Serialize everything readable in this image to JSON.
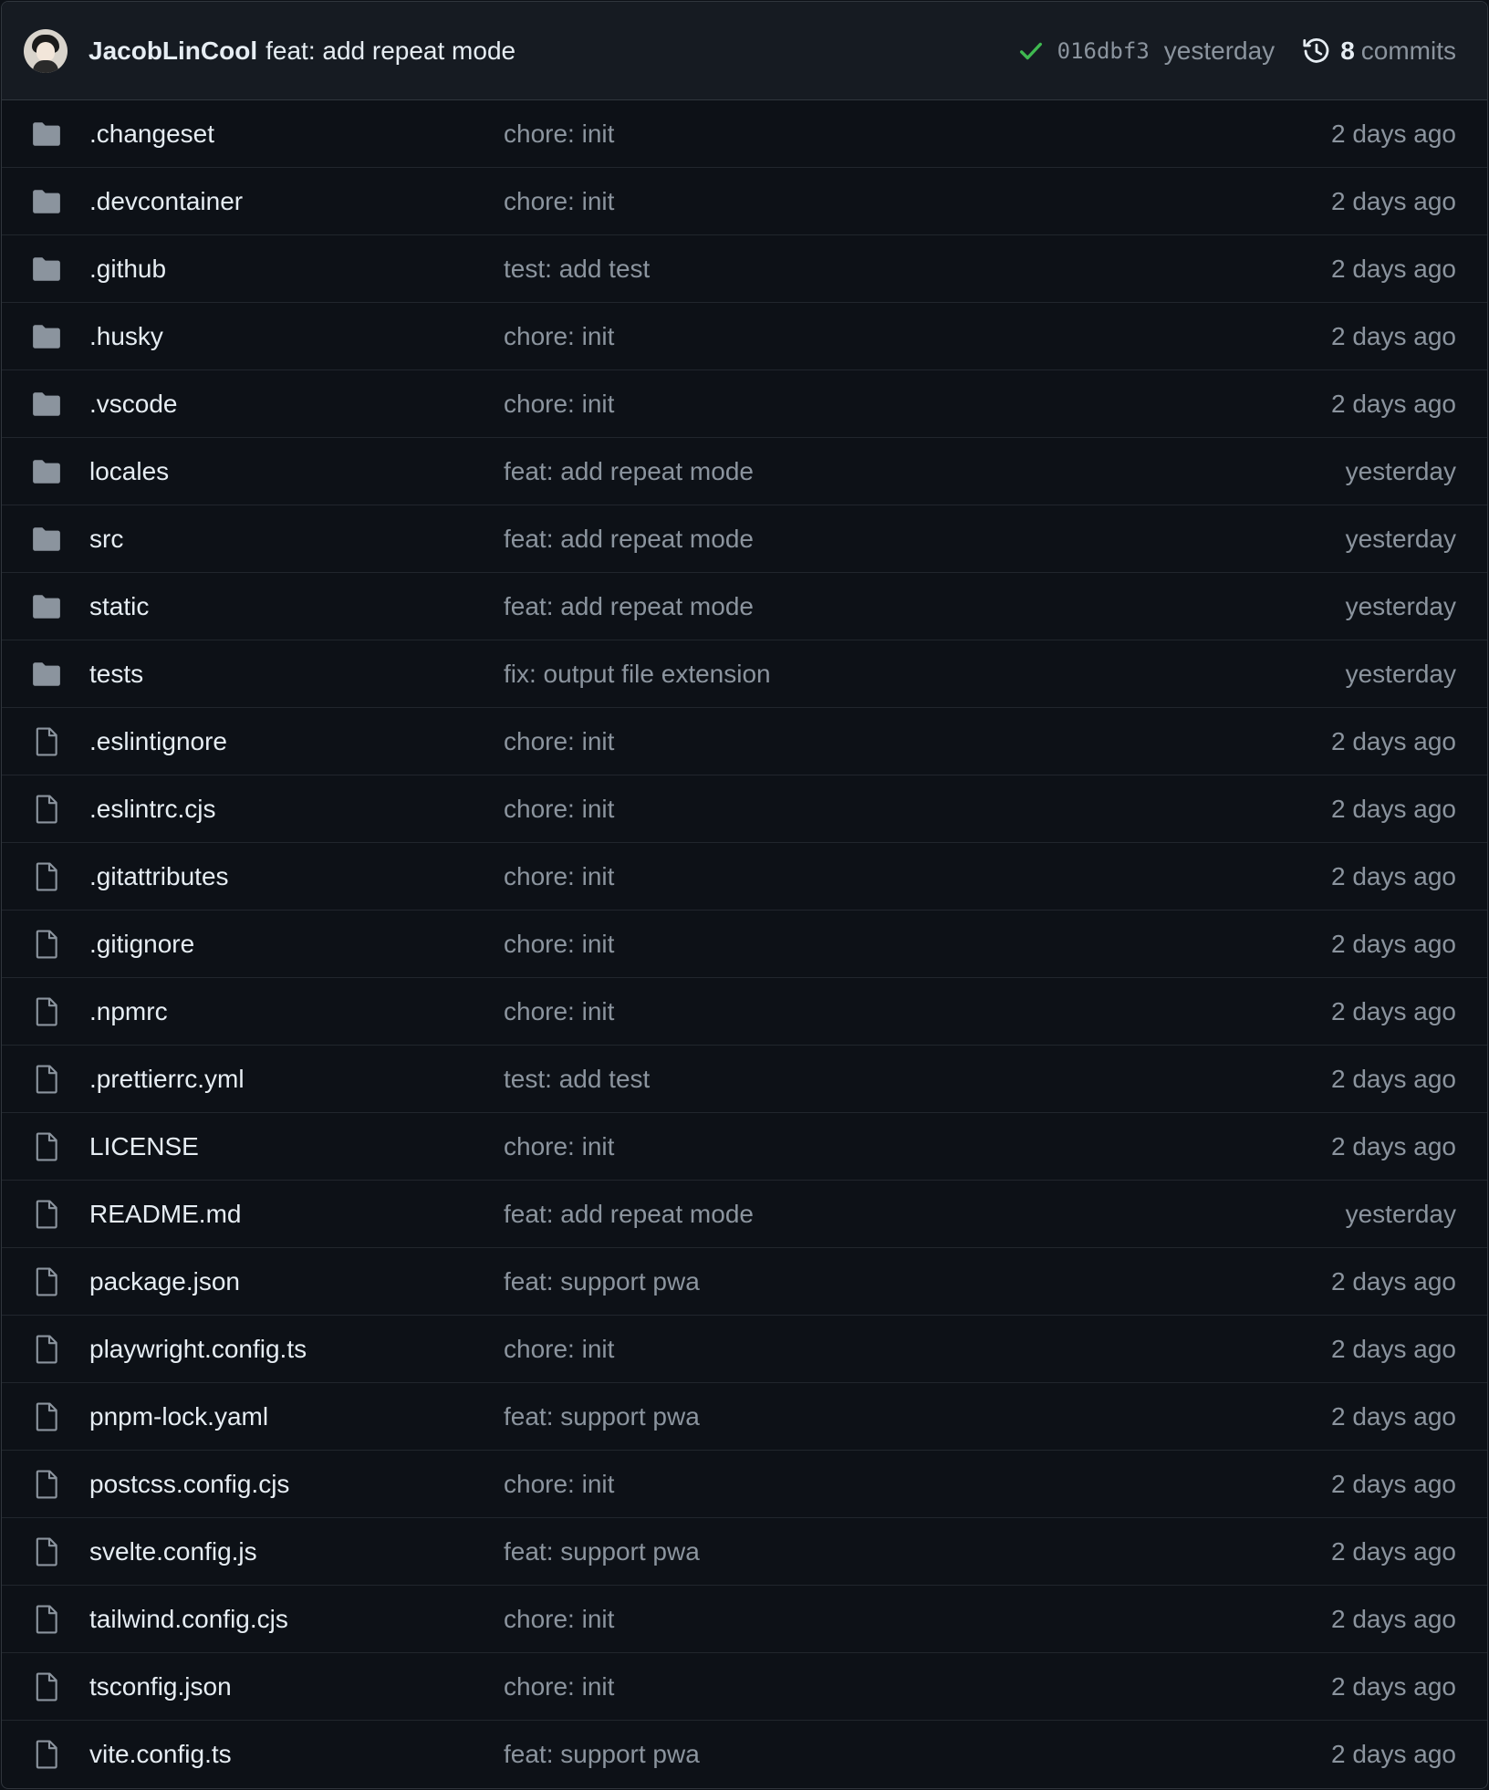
{
  "header": {
    "author": "JacobLinCool",
    "message": "feat: add repeat mode",
    "sha": "016dbf3",
    "time": "yesterday",
    "commit_count": "8",
    "commit_label": "commits",
    "status": "success"
  },
  "colors": {
    "background": "#0d1117",
    "header_background": "#161b22",
    "border": "#30363d",
    "text": "#e6edf3",
    "muted": "#8b949e",
    "success": "#3fb950",
    "icon": "#8b949e"
  },
  "files": [
    {
      "name": ".changeset",
      "type": "folder",
      "message": "chore: init",
      "age": "2 days ago"
    },
    {
      "name": ".devcontainer",
      "type": "folder",
      "message": "chore: init",
      "age": "2 days ago"
    },
    {
      "name": ".github",
      "type": "folder",
      "message": "test: add test",
      "age": "2 days ago"
    },
    {
      "name": ".husky",
      "type": "folder",
      "message": "chore: init",
      "age": "2 days ago"
    },
    {
      "name": ".vscode",
      "type": "folder",
      "message": "chore: init",
      "age": "2 days ago"
    },
    {
      "name": "locales",
      "type": "folder",
      "message": "feat: add repeat mode",
      "age": "yesterday"
    },
    {
      "name": "src",
      "type": "folder",
      "message": "feat: add repeat mode",
      "age": "yesterday"
    },
    {
      "name": "static",
      "type": "folder",
      "message": "feat: add repeat mode",
      "age": "yesterday"
    },
    {
      "name": "tests",
      "type": "folder",
      "message": "fix: output file extension",
      "age": "yesterday"
    },
    {
      "name": ".eslintignore",
      "type": "file",
      "message": "chore: init",
      "age": "2 days ago"
    },
    {
      "name": ".eslintrc.cjs",
      "type": "file",
      "message": "chore: init",
      "age": "2 days ago"
    },
    {
      "name": ".gitattributes",
      "type": "file",
      "message": "chore: init",
      "age": "2 days ago"
    },
    {
      "name": ".gitignore",
      "type": "file",
      "message": "chore: init",
      "age": "2 days ago"
    },
    {
      "name": ".npmrc",
      "type": "file",
      "message": "chore: init",
      "age": "2 days ago"
    },
    {
      "name": ".prettierrc.yml",
      "type": "file",
      "message": "test: add test",
      "age": "2 days ago"
    },
    {
      "name": "LICENSE",
      "type": "file",
      "message": "chore: init",
      "age": "2 days ago"
    },
    {
      "name": "README.md",
      "type": "file",
      "message": "feat: add repeat mode",
      "age": "yesterday"
    },
    {
      "name": "package.json",
      "type": "file",
      "message": "feat: support pwa",
      "age": "2 days ago"
    },
    {
      "name": "playwright.config.ts",
      "type": "file",
      "message": "chore: init",
      "age": "2 days ago"
    },
    {
      "name": "pnpm-lock.yaml",
      "type": "file",
      "message": "feat: support pwa",
      "age": "2 days ago"
    },
    {
      "name": "postcss.config.cjs",
      "type": "file",
      "message": "chore: init",
      "age": "2 days ago"
    },
    {
      "name": "svelte.config.js",
      "type": "file",
      "message": "feat: support pwa",
      "age": "2 days ago"
    },
    {
      "name": "tailwind.config.cjs",
      "type": "file",
      "message": "chore: init",
      "age": "2 days ago"
    },
    {
      "name": "tsconfig.json",
      "type": "file",
      "message": "chore: init",
      "age": "2 days ago"
    },
    {
      "name": "vite.config.ts",
      "type": "file",
      "message": "feat: support pwa",
      "age": "2 days ago"
    }
  ]
}
